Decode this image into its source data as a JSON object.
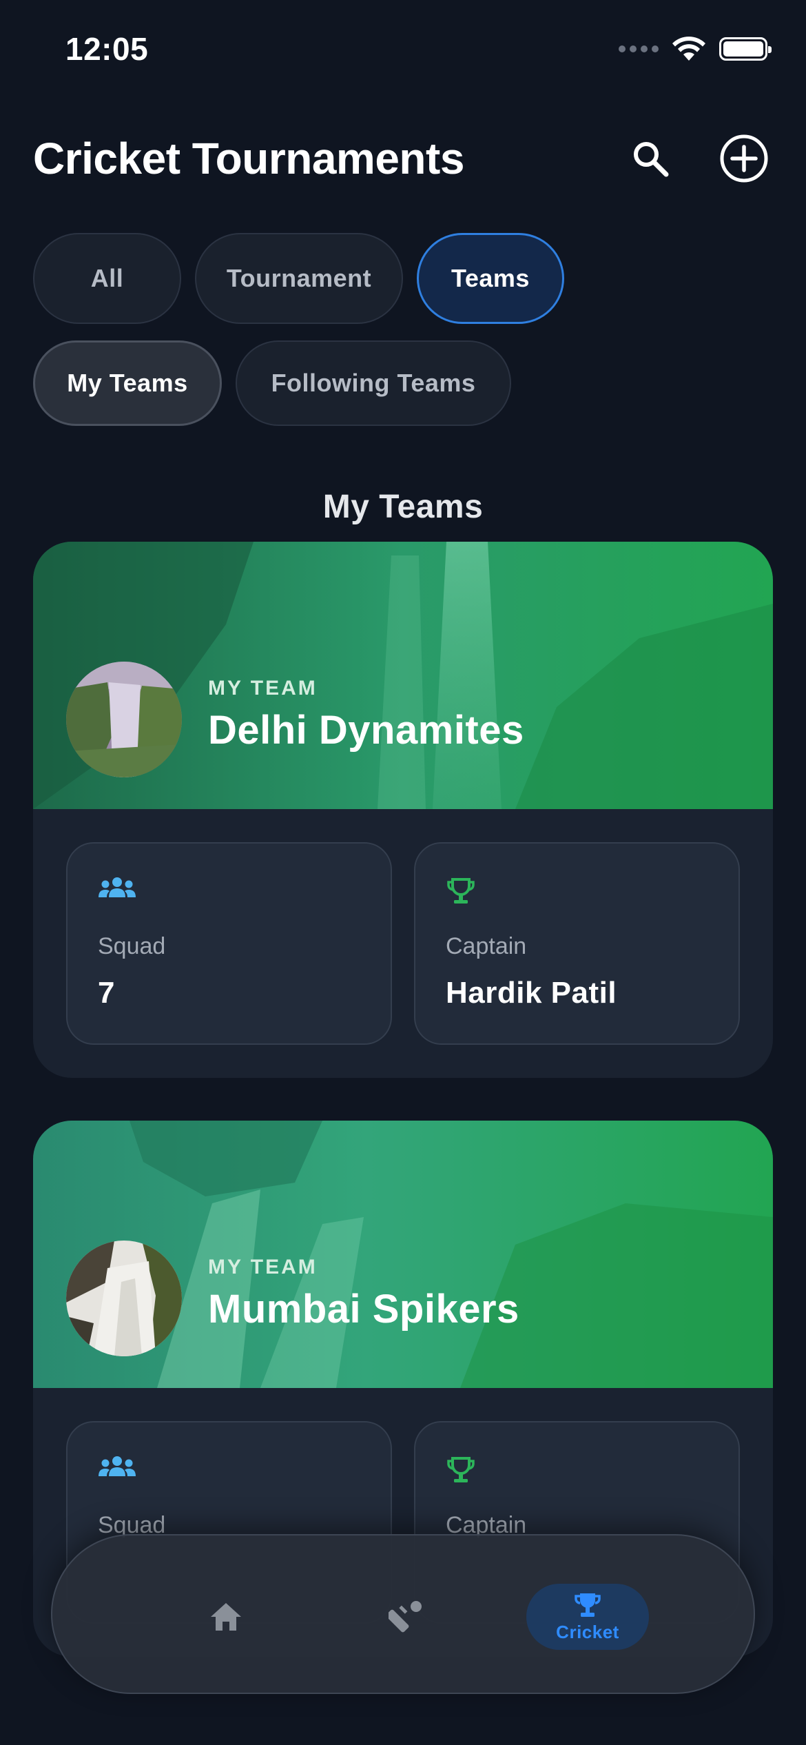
{
  "status_bar": {
    "time": "12:05"
  },
  "header": {
    "title": "Cricket Tournaments",
    "search_icon": "search-icon",
    "add_icon": "add-circle-icon"
  },
  "filters": {
    "primary": [
      {
        "label": "All",
        "selected": false
      },
      {
        "label": "Tournament",
        "selected": false
      },
      {
        "label": "Teams",
        "selected": true
      }
    ],
    "secondary": [
      {
        "label": "My Teams",
        "selected": true
      },
      {
        "label": "Following Teams",
        "selected": false
      }
    ]
  },
  "section": {
    "title": "My Teams"
  },
  "teams": [
    {
      "eyebrow": "MY TEAM",
      "name": "Delhi Dynamites",
      "squad_label": "Squad",
      "squad_value": "7",
      "captain_label": "Captain",
      "captain_value": "Hardik Patil"
    },
    {
      "eyebrow": "MY TEAM",
      "name": "Mumbai Spikers",
      "squad_label": "Squad",
      "captain_label": "Captain"
    }
  ],
  "bottom_nav": {
    "items": [
      {
        "icon": "home-icon",
        "label": "",
        "active": false
      },
      {
        "icon": "cricket-bat-icon",
        "label": "",
        "active": false
      },
      {
        "icon": "trophy-icon",
        "label": "Cricket",
        "active": true
      }
    ]
  },
  "colors": {
    "background": "#0f1521",
    "accent_blue": "#2f8cff",
    "banner_green": "#22a552",
    "squad_icon": "#4fb3f0",
    "captain_icon": "#2cb55a"
  }
}
